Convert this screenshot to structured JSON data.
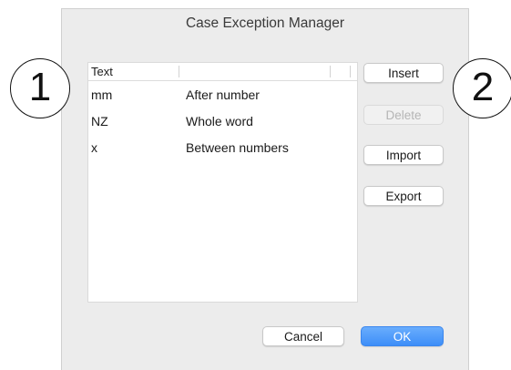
{
  "dialog": {
    "title": "Case Exception Manager"
  },
  "table": {
    "columns": [
      "Text",
      ""
    ],
    "rows": [
      {
        "text": "mm",
        "type": "After number"
      },
      {
        "text": "NZ",
        "type": "Whole word"
      },
      {
        "text": "x",
        "type": "Between numbers"
      }
    ]
  },
  "buttons": {
    "insert": "Insert",
    "delete": "Delete",
    "import": "Import",
    "export": "Export",
    "cancel": "Cancel",
    "ok": "OK"
  },
  "callouts": [
    "1",
    "2"
  ],
  "colors": {
    "primary_button": "#3d8ef8",
    "dialog_background": "#ececec"
  }
}
